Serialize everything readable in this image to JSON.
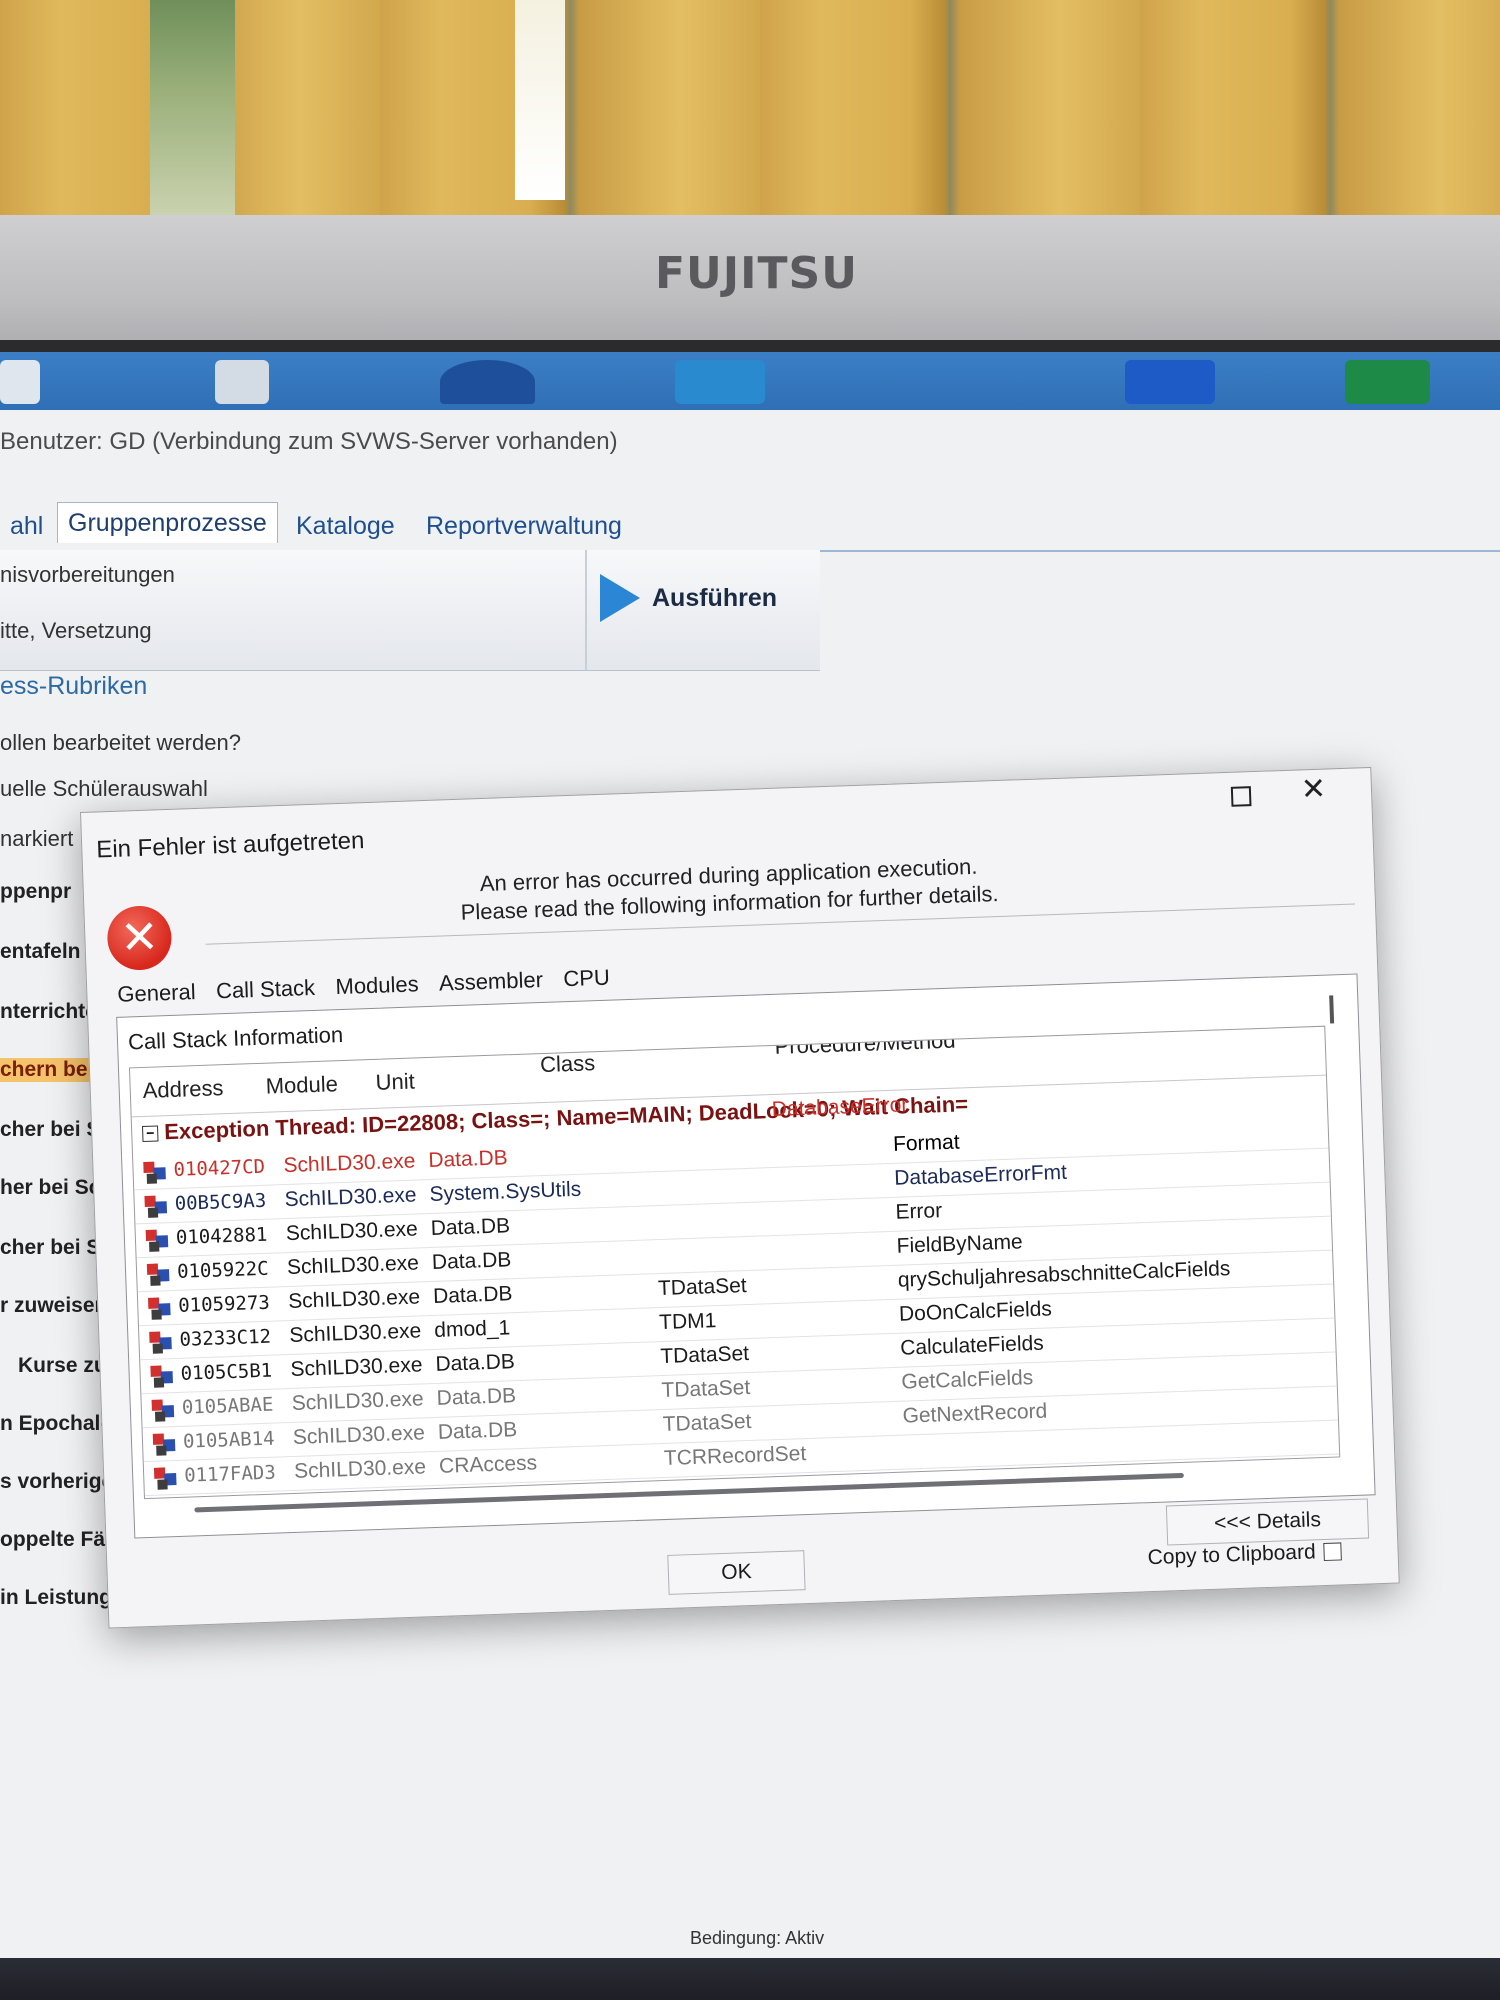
{
  "monitor": {
    "brand": "FUJITSU"
  },
  "app": {
    "status_line": "Benutzer: GD (Verbindung zum SVWS-Server vorhanden)",
    "tabs": [
      "ahl",
      "Gruppenprozesse",
      "Kataloge",
      "Reportverwaltung"
    ],
    "ribbon_items": [
      "nisvorbereitungen",
      "itte, Versetzung"
    ],
    "run_button_label": "Ausführen",
    "section_title": "ess-Rubriken",
    "questions": [
      "ollen bearbeitet werden?",
      "uelle Schülerauswahl",
      "narkiert"
    ],
    "left_list": [
      "ppenpr",
      "entafeln :",
      "nterrichte",
      "chern bei",
      "cher bei S",
      "her bei Sch",
      "cher bei Sch",
      "r zuweisen (",
      "Kurse zuw",
      "n Epochal-Fä",
      "s vorherigen",
      "oppelte Fäche",
      "in Leistungsdat"
    ],
    "bottom_status": "Bedingung: Aktiv"
  },
  "dialog": {
    "title": "Ein Fehler ist aufgetreten",
    "message_line1": "An error has occurred during application execution.",
    "message_line2": "Please read the following information for further details.",
    "tabs": [
      "General",
      "Call Stack",
      "Modules",
      "Assembler",
      "CPU"
    ],
    "panel_title": "Call Stack Information",
    "columns": {
      "address": "Address",
      "module": "Module",
      "unit": "Unit",
      "class": "Class",
      "procedure": "Procedure/Method"
    },
    "exception_line": "Exception Thread: ID=22808; Class=; Name=MAIN; DeadLock=0; Wait Chain=",
    "exception_proc": "DatabaseError",
    "rows": [
      {
        "address": "010427CD",
        "module": "SchILD30.exe",
        "unit": "Data.DB",
        "class": "",
        "procedure": "Format",
        "style": "red"
      },
      {
        "address": "00B5C9A3",
        "module": "SchILD30.exe",
        "unit": "System.SysUtils",
        "class": "",
        "procedure": "DatabaseErrorFmt",
        "style": "navy"
      },
      {
        "address": "01042881",
        "module": "SchILD30.exe",
        "unit": "Data.DB",
        "class": "",
        "procedure": "Error",
        "style": "dark"
      },
      {
        "address": "0105922C",
        "module": "SchILD30.exe",
        "unit": "Data.DB",
        "class": "",
        "procedure": "FieldByName",
        "style": "dark"
      },
      {
        "address": "01059273",
        "module": "SchILD30.exe",
        "unit": "Data.DB",
        "class": "TDataSet",
        "procedure": "qrySchuljahresabschnitteCalcFields",
        "style": "dark"
      },
      {
        "address": "03233C12",
        "module": "SchILD30.exe",
        "unit": "dmod_1",
        "class": "TDM1",
        "procedure": "DoOnCalcFields",
        "style": "dark"
      },
      {
        "address": "0105C5B1",
        "module": "SchILD30.exe",
        "unit": "Data.DB",
        "class": "TDataSet",
        "procedure": "CalculateFields",
        "style": "dark"
      },
      {
        "address": "0105ABAE",
        "module": "SchILD30.exe",
        "unit": "Data.DB",
        "class": "TDataSet",
        "procedure": "GetCalcFields",
        "style": "gray"
      },
      {
        "address": "0105AB14",
        "module": "SchILD30.exe",
        "unit": "Data.DB",
        "class": "TDataSet",
        "procedure": "GetNextRecord",
        "style": "gray"
      },
      {
        "address": "0117FAD3",
        "module": "SchILD30.exe",
        "unit": "CRAccess",
        "class": "TCRRecordSet",
        "procedure": "",
        "style": "gray"
      }
    ],
    "details_button": "<<< Details",
    "ok_button": "OK",
    "copy_label": "Copy to Clipboard"
  }
}
